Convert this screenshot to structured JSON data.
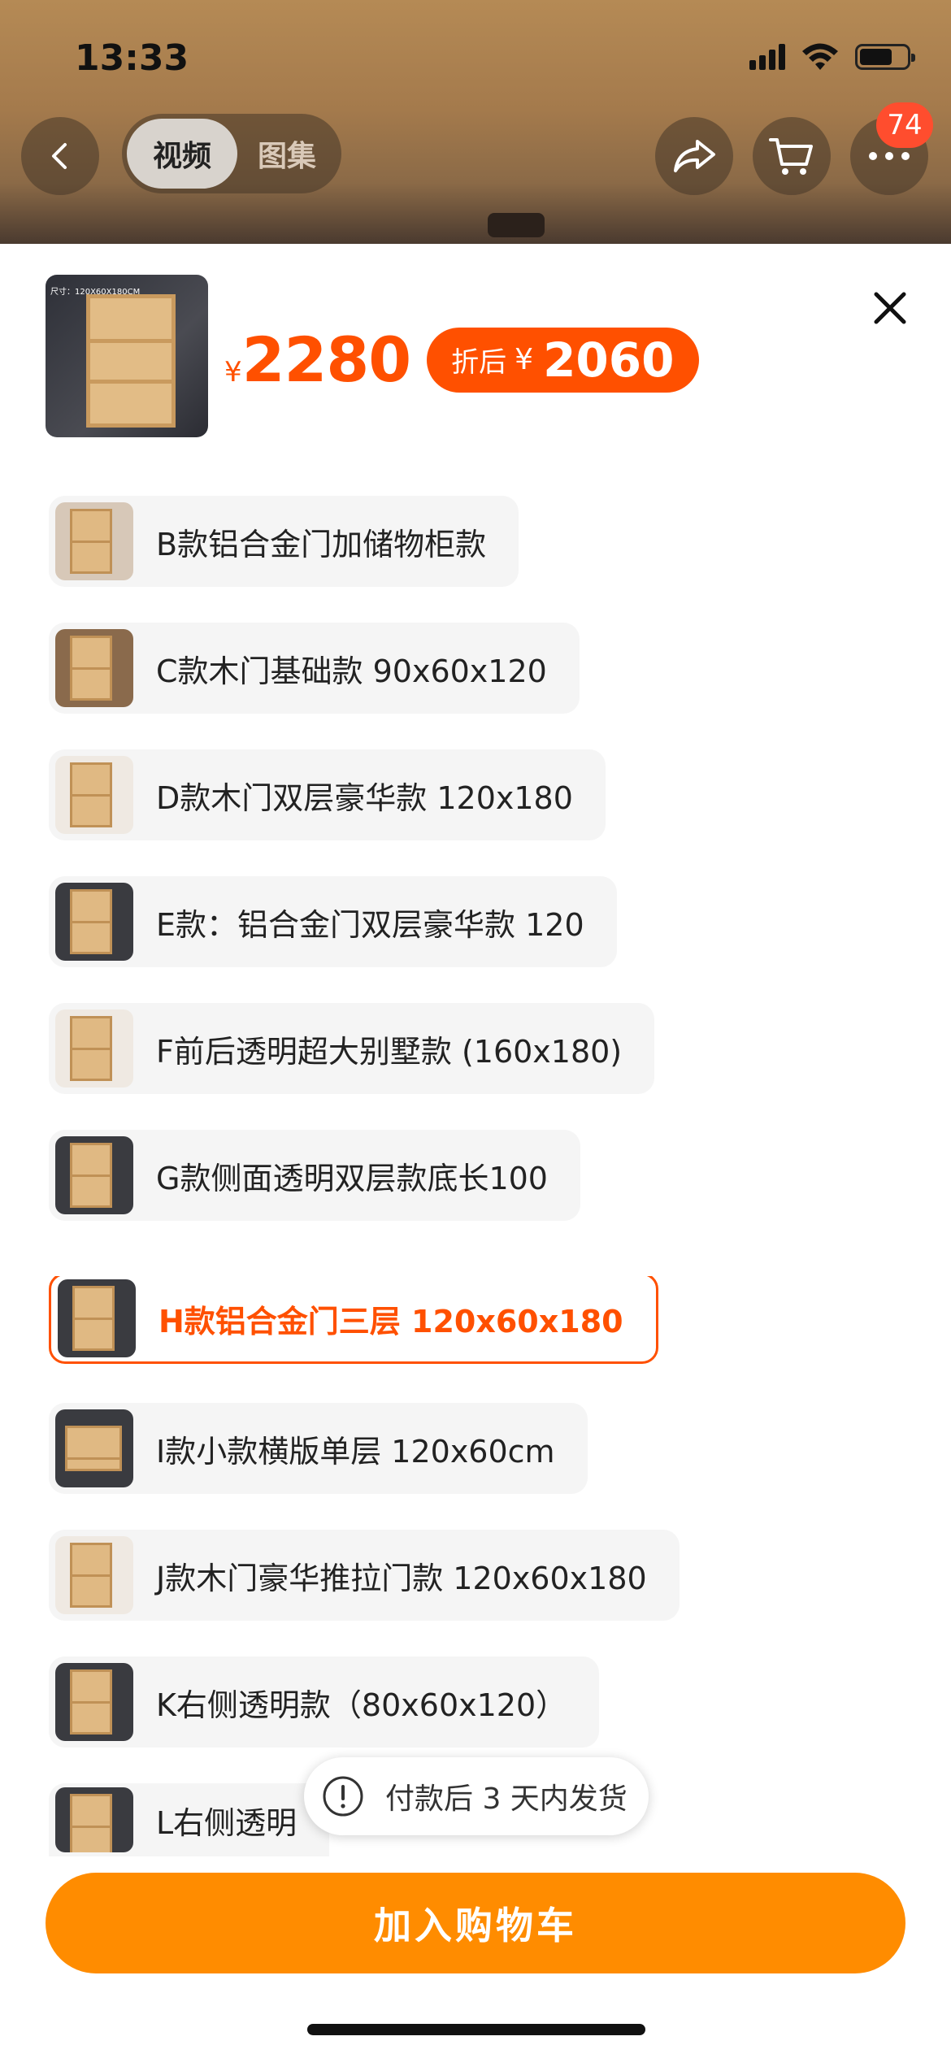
{
  "status_bar": {
    "time": "13:33"
  },
  "header": {
    "media_tabs": [
      {
        "label": "视频",
        "active": true
      },
      {
        "label": "图集",
        "active": false
      }
    ],
    "cart_badge": "74"
  },
  "product": {
    "thumb_caption": "尺寸：120X60X180CM",
    "price_symbol": "¥",
    "price": "2280",
    "discount_label": "折后",
    "discount_symbol": "¥",
    "discount_price": "2060"
  },
  "sku_options": [
    {
      "label": "B款铝合金门加储物柜款",
      "selected": false
    },
    {
      "label": "C款木门基础款 90x60x120",
      "selected": false
    },
    {
      "label": "D款木门双层豪华款 120x180",
      "selected": false
    },
    {
      "label": "E款：铝合金门双层豪华款 120",
      "selected": false
    },
    {
      "label": "F前后透明超大别墅款 (160x180)",
      "selected": false
    },
    {
      "label": "G款侧面透明双层款底长100",
      "selected": false
    },
    {
      "label": "H款铝合金门三层 120x60x180",
      "selected": true
    },
    {
      "label": "I款小款横版单层 120x60cm",
      "selected": false
    },
    {
      "label": "J款木门豪华推拉门款 120x60x180",
      "selected": false
    },
    {
      "label": "K右侧透明款（80x60x120）",
      "selected": false
    },
    {
      "label": "L右侧透明",
      "selected": false
    }
  ],
  "toast": {
    "text": "付款后 3 天内发货"
  },
  "footer": {
    "add_to_cart_label": "加入购物车"
  },
  "colors": {
    "accent": "#ff5000",
    "cart_button": "#ff8c00",
    "badge": "#ff4d2e"
  }
}
